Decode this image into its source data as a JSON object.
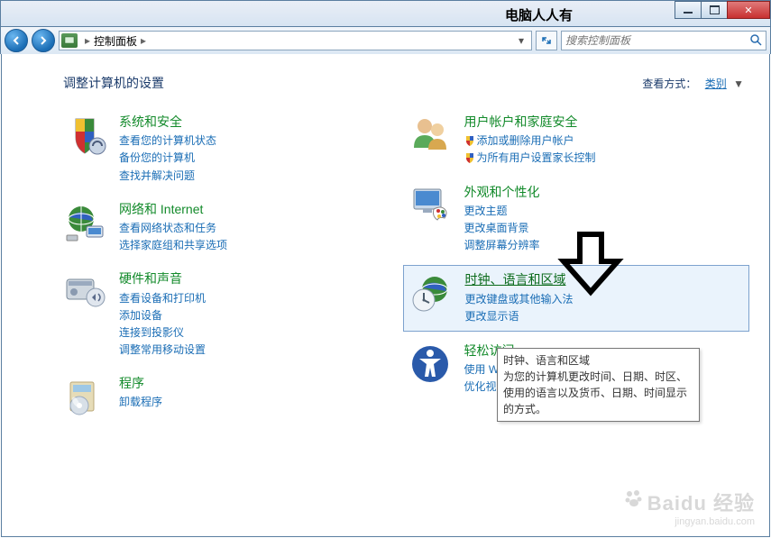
{
  "titlebar": {
    "text": "电脑人人有"
  },
  "nav": {
    "breadcrumb": "控制面板",
    "search_placeholder": "搜索控制面板"
  },
  "header": {
    "title": "调整计算机的设置",
    "view_label": "查看方式：",
    "view_value": "类别"
  },
  "cats": {
    "left": [
      {
        "title": "系统和安全",
        "subs": [
          {
            "label": "查看您的计算机状态",
            "shield": false
          },
          {
            "label": "备份您的计算机",
            "shield": false
          },
          {
            "label": "查找并解决问题",
            "shield": false
          }
        ]
      },
      {
        "title": "网络和 Internet",
        "subs": [
          {
            "label": "查看网络状态和任务",
            "shield": false
          },
          {
            "label": "选择家庭组和共享选项",
            "shield": false
          }
        ]
      },
      {
        "title": "硬件和声音",
        "subs": [
          {
            "label": "查看设备和打印机",
            "shield": false
          },
          {
            "label": "添加设备",
            "shield": false
          },
          {
            "label": "连接到投影仪",
            "shield": false
          },
          {
            "label": "调整常用移动设置",
            "shield": false
          }
        ]
      },
      {
        "title": "程序",
        "subs": [
          {
            "label": "卸载程序",
            "shield": false
          }
        ]
      }
    ],
    "right": [
      {
        "title": "用户帐户和家庭安全",
        "subs": [
          {
            "label": "添加或删除用户帐户",
            "shield": true
          },
          {
            "label": "为所有用户设置家长控制",
            "shield": true
          }
        ]
      },
      {
        "title": "外观和个性化",
        "subs": [
          {
            "label": "更改主题",
            "shield": false
          },
          {
            "label": "更改桌面背景",
            "shield": false
          },
          {
            "label": "调整屏幕分辨率",
            "shield": false
          }
        ]
      },
      {
        "title": "时钟、语言和区域",
        "highlight": true,
        "subs": [
          {
            "label": "更改键盘或其他输入法",
            "shield": false
          },
          {
            "label": "更改显示语言",
            "shield": false,
            "truncated": "更改显示语"
          }
        ]
      },
      {
        "title": "轻松访问",
        "truncated_title": "轻松访问",
        "subs": [
          {
            "label": "使用 Windows 建议的设置",
            "truncated": "使用 Windo",
            "shield": false
          },
          {
            "label": "优化视频显示",
            "shield": false
          }
        ]
      }
    ]
  },
  "tooltip": {
    "title": "时钟、语言和区域",
    "body": "为您的计算机更改时间、日期、时区、使用的语言以及货币、日期、时间显示的方式。"
  },
  "watermark": {
    "brand": "Baidu 经验",
    "url": "jingyan.baidu.com"
  }
}
